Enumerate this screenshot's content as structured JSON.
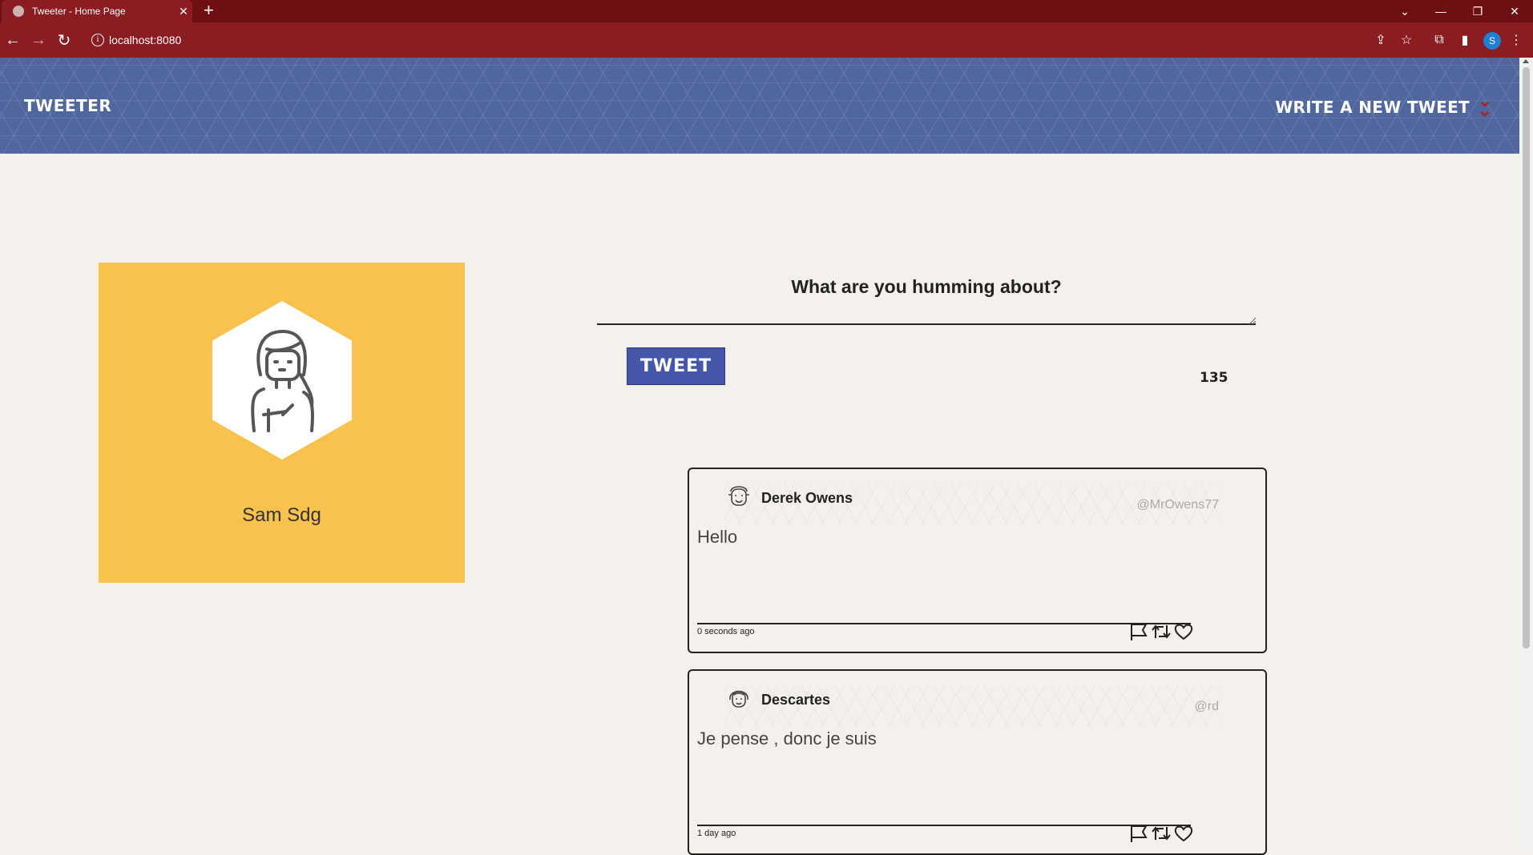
{
  "browser": {
    "tab_title": "Tweeter - Home Page",
    "tab_close": "✕",
    "new_tab": "+",
    "url": "localhost:8080",
    "profile_initial": "S"
  },
  "header": {
    "brand": "TWEETER",
    "write_link": "WRITE A NEW TWEET"
  },
  "profile": {
    "name": "Sam Sdg"
  },
  "compose": {
    "title": "What are you humming about?",
    "button_label": "TWEET",
    "counter": "135"
  },
  "tweets": [
    {
      "name": "Derek Owens",
      "handle": "@MrOwens77",
      "text": "Hello",
      "time": "0 seconds ago"
    },
    {
      "name": "Descartes",
      "handle": "@rd",
      "text": "Je pense , donc je suis",
      "time": "1 day ago"
    }
  ],
  "colors": {
    "chrome": "#8a1c22",
    "header": "#4f679e",
    "card": "#f9c24c",
    "button": "#4656a8",
    "accent": "#a3262d"
  }
}
